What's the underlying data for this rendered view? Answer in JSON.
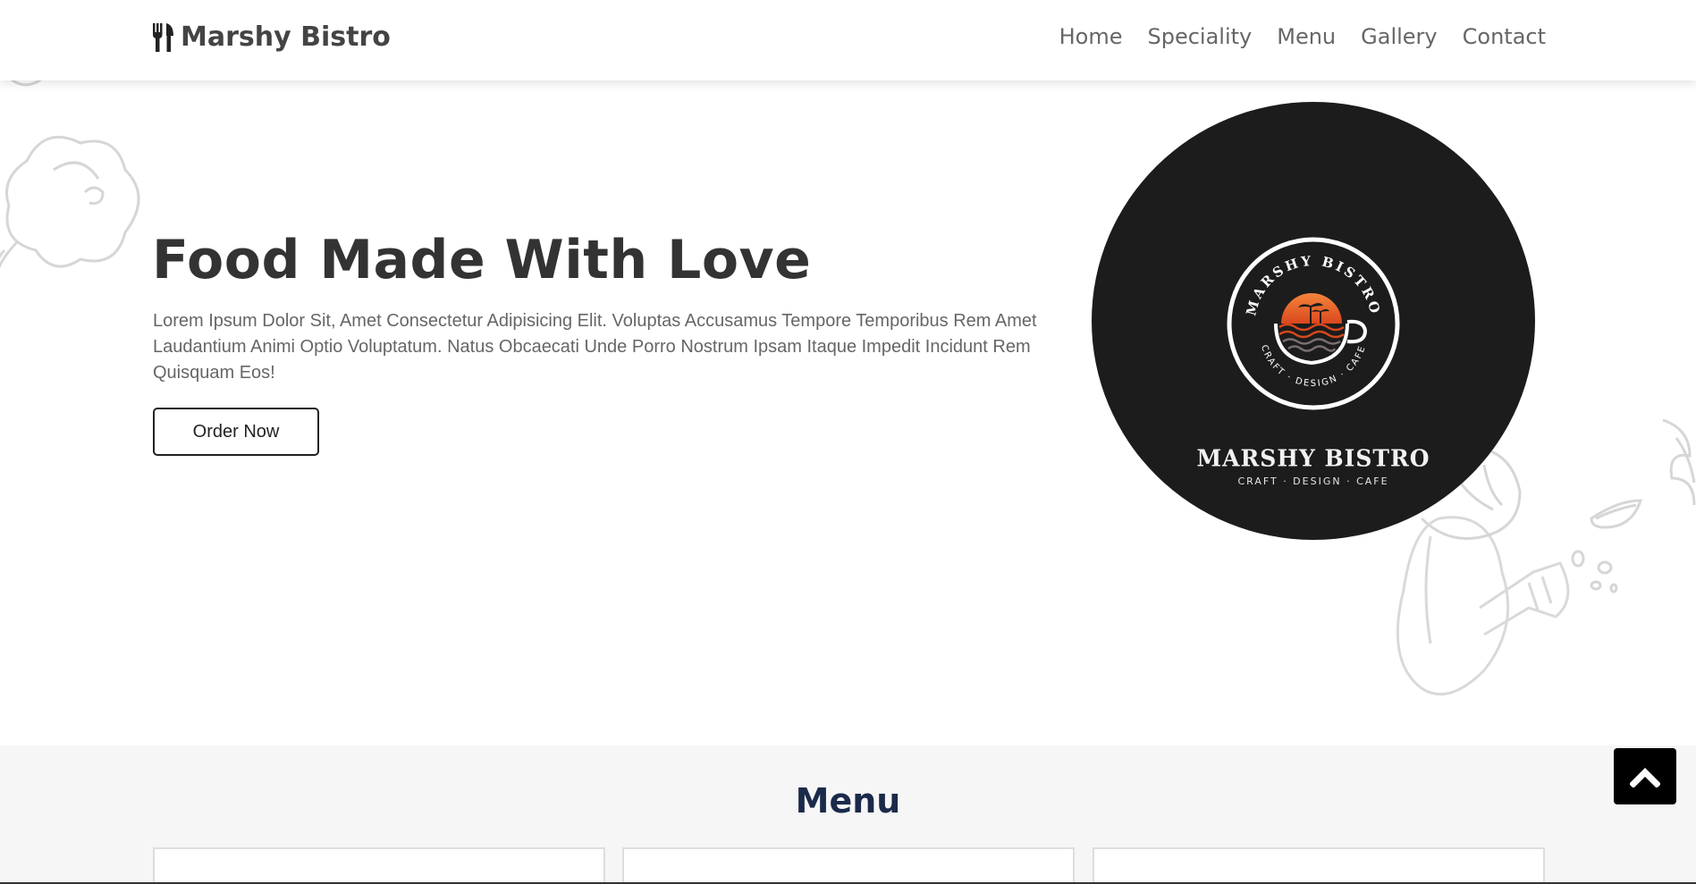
{
  "header": {
    "brand": "Marshy Bistro",
    "brand_icon": "utensils-icon",
    "nav": [
      "Home",
      "Speciality",
      "Menu",
      "Gallery",
      "Contact"
    ]
  },
  "hero": {
    "title": "Food Made With Love",
    "description": "Lorem Ipsum Dolor Sit, Amet Consectetur Adipisicing Elit. Voluptas Accusamus Tempore Temporibus Rem Amet Laudantium Animi Optio Voluptatum. Natus Obcaecati Unde Porro Nostrum Ipsam Itaque Impedit Incidunt Rem Quisquam Eos!",
    "cta": "Order Now",
    "logo": {
      "ring_text": "MARSHY BISTRO",
      "ring_bottom_text": "CRAFT · DESIGN · CAFE",
      "name": "MARSHY BISTRO",
      "tagline": "CRAFT · DESIGN · CAFE"
    }
  },
  "menu": {
    "heading": "Menu",
    "card_count": 3
  },
  "colors": {
    "accent_dark": "#1c1c1c",
    "sunset_orange": "#e8622a",
    "text_primary": "#333333",
    "text_secondary": "#666666",
    "section_bg": "#f6f6f6"
  },
  "icons": {
    "scroll_top": "chevron-up-icon"
  }
}
